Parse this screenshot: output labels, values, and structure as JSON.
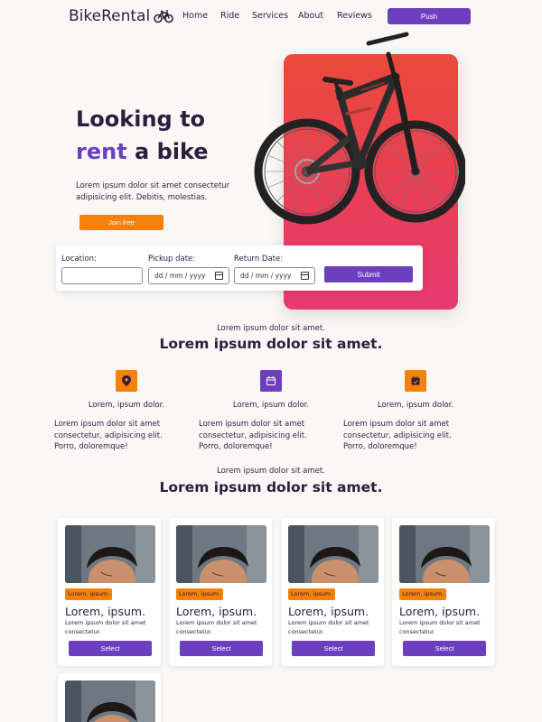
{
  "nav": {
    "logo": "BikeRental",
    "links": [
      "Home",
      "Ride",
      "Services",
      "About",
      "Reviews"
    ],
    "push_label": "Push"
  },
  "hero": {
    "title_line1": "Looking to",
    "title_accent": "rent",
    "title_rest": "a bike",
    "description": "Lorem ipsum dolor sit amet consectetur adipisicing elit. Debitis, molestias.",
    "join_label": "Join free"
  },
  "booking": {
    "location_label": "Location:",
    "pickup_label": "Pickup date:",
    "return_label": "Return Date:",
    "date_placeholder": "dd / mm / yyyy",
    "submit_label": "Submit"
  },
  "section1": {
    "subtitle": "Lorem ipsum dolor sit amet.",
    "title": "Lorem ipsum dolor sit amet.",
    "features": [
      {
        "icon": "map-pin-icon",
        "color": "#f5800c",
        "title": "Lorem, ipsum dolor.",
        "text": "Lorem ipsum dolor sit amet consectetur, adipisicing elit. Porro, doloremque!"
      },
      {
        "icon": "calendar-icon",
        "color": "#6b3fbd",
        "title": "Lorem, ipsum dolor.",
        "text": "Lorem ipsum dolor sit amet consectetur, adipisicing elit. Porro, doloremque!"
      },
      {
        "icon": "calendar-check-icon",
        "color": "#f5800c",
        "title": "Lorem, ipsum dolor.",
        "text": "Lorem ipsum dolor sit amet consectetur, adipisicing elit. Porro, doloremque!"
      }
    ]
  },
  "section2": {
    "subtitle": "Lorem ipsum dolor sit amet.",
    "title": "Lorem ipsum dolor sit amet.",
    "cards": [
      {
        "tag": "Lorem, ipsum.",
        "title": "Lorem, ipsum.",
        "text": "Lorem ipsum dolor sit amet consectetur.",
        "button": "Select"
      },
      {
        "tag": "Lorem, ipsum.",
        "title": "Lorem, ipsum.",
        "text": "Lorem ipsum dolor sit amet consectetur.",
        "button": "Select"
      },
      {
        "tag": "Lorem, ipsum.",
        "title": "Lorem, ipsum.",
        "text": "Lorem ipsum dolor sit amet consectetur.",
        "button": "Select"
      },
      {
        "tag": "Lorem, ipsum.",
        "title": "Lorem, ipsum.",
        "text": "Lorem ipsum dolor sit amet consectetur.",
        "button": "Select"
      }
    ]
  },
  "colors": {
    "accent_purple": "#6b3fbd",
    "accent_orange": "#f5800c",
    "hero_gradient_top": "#ea4a3a",
    "hero_gradient_bottom": "#e83a72"
  }
}
